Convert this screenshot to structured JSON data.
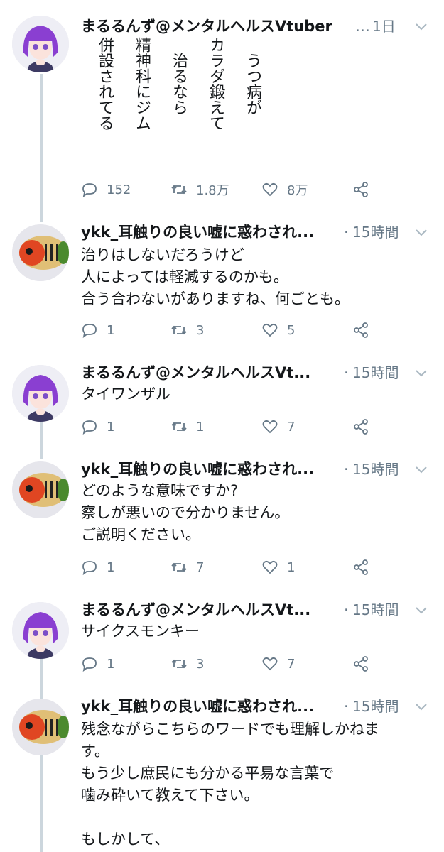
{
  "tweets": [
    {
      "name": "まるるんず@メンタルヘルスVtuber",
      "time": "1日",
      "vertical_columns": [
        "うつ病が",
        "カラダ鍛えて",
        "治るなら",
        "精神科にジム",
        "併設されてる"
      ],
      "replies": "152",
      "retweets": "1.8万",
      "likes": "8万"
    },
    {
      "name": "ykk_耳触りの良い嘘に惑わされ...",
      "time": "15時間",
      "text": "治りはしないだろうけど\n人によっては軽減するのかも。\n合う合わないがありますね、何ごとも。",
      "replies": "1",
      "retweets": "3",
      "likes": "5"
    },
    {
      "name": "まるるんず@メンタルヘルスVt...",
      "time": "15時間",
      "text": "タイワンザル",
      "replies": "1",
      "retweets": "1",
      "likes": "7"
    },
    {
      "name": "ykk_耳触りの良い嘘に惑わされ...",
      "time": "15時間",
      "text": "どのような意味ですか?\n察しが悪いので分かりません。\nご説明ください。",
      "replies": "1",
      "retweets": "7",
      "likes": "1"
    },
    {
      "name": "まるるんず@メンタルヘルスVt...",
      "time": "15時間",
      "text": "サイクスモンキー",
      "replies": "1",
      "retweets": "3",
      "likes": "7"
    },
    {
      "name": "ykk_耳触りの良い嘘に惑わされ...",
      "time": "15時間",
      "text": "残念ながらこちらのワードでも理解しかねま\nす。\nもう少し庶民にも分かる平易な言葉で\n噛み砕いて教えて下さい。\n\nもしかして、"
    }
  ],
  "colors": {
    "text": "#14171a",
    "secondary": "#657786",
    "thread_line": "#ccd6dd"
  },
  "icons": [
    "reply-icon",
    "retweet-icon",
    "like-icon",
    "share-icon",
    "chevron-down-icon"
  ]
}
